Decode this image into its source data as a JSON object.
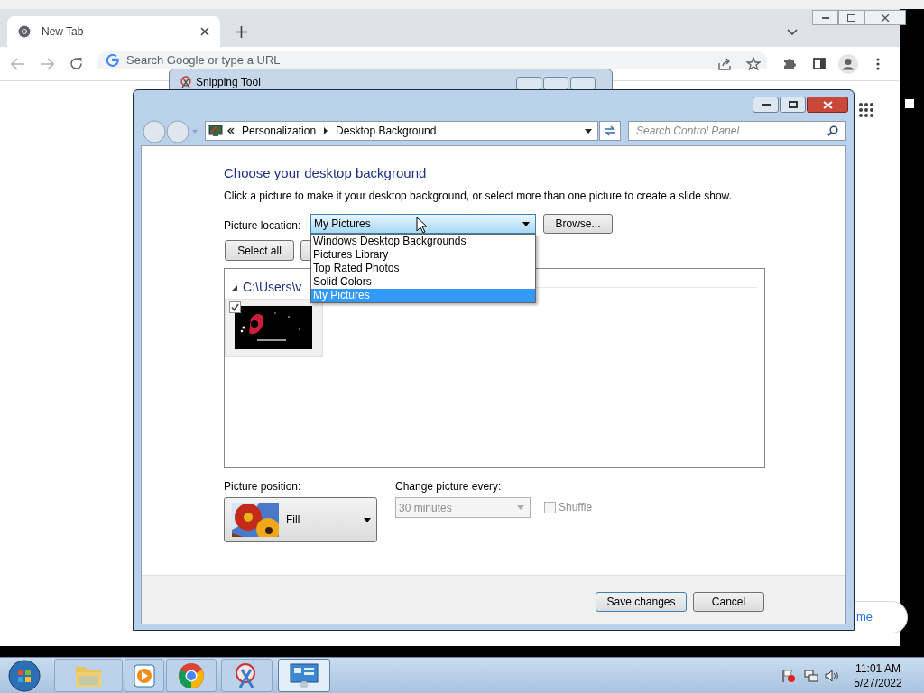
{
  "browser": {
    "tab": {
      "title": "New Tab",
      "selected": true
    },
    "omnibox": {
      "placeholder": "Search Google or type a URL"
    },
    "page_fragment": "me"
  },
  "snipping_tool": {
    "title": "Snipping Tool"
  },
  "control_panel": {
    "breadcrumb": [
      "Personalization",
      "Desktop Background"
    ],
    "search": {
      "placeholder": "Search Control Panel"
    },
    "heading": "Choose your desktop background",
    "description": "Click a picture to make it your desktop background, or select more than one picture to create a slide show.",
    "picture_location": {
      "label": "Picture location:",
      "value": "My Pictures",
      "expanded": true,
      "options": [
        {
          "label": "Windows Desktop Backgrounds",
          "selected": false
        },
        {
          "label": "Pictures Library",
          "selected": false
        },
        {
          "label": "Top Rated Photos",
          "selected": false
        },
        {
          "label": "Solid Colors",
          "selected": false
        },
        {
          "label": "My Pictures",
          "selected": true
        }
      ]
    },
    "browse_button": "Browse...",
    "select_all_button": "Select all",
    "group_header": "C:\\Users\\v",
    "thumbnails": [
      {
        "checked": true
      }
    ],
    "picture_position": {
      "label": "Picture position:",
      "value": "Fill"
    },
    "change_picture": {
      "label": "Change picture every:",
      "value": "30 minutes",
      "disabled": true
    },
    "shuffle": {
      "label": "Shuffle",
      "checked": false,
      "disabled": true
    },
    "buttons": [
      "Save changes",
      "Cancel"
    ]
  },
  "taskbar": {
    "items": [
      {
        "kind": "folder",
        "selected": false
      },
      {
        "kind": "media",
        "selected": false
      },
      {
        "kind": "chrome",
        "selected": false
      },
      {
        "kind": "scissors",
        "selected": false
      },
      {
        "kind": "panel",
        "selected": true
      }
    ],
    "clock": {
      "time": "11:01 AM",
      "date": "5/27/2022"
    }
  }
}
